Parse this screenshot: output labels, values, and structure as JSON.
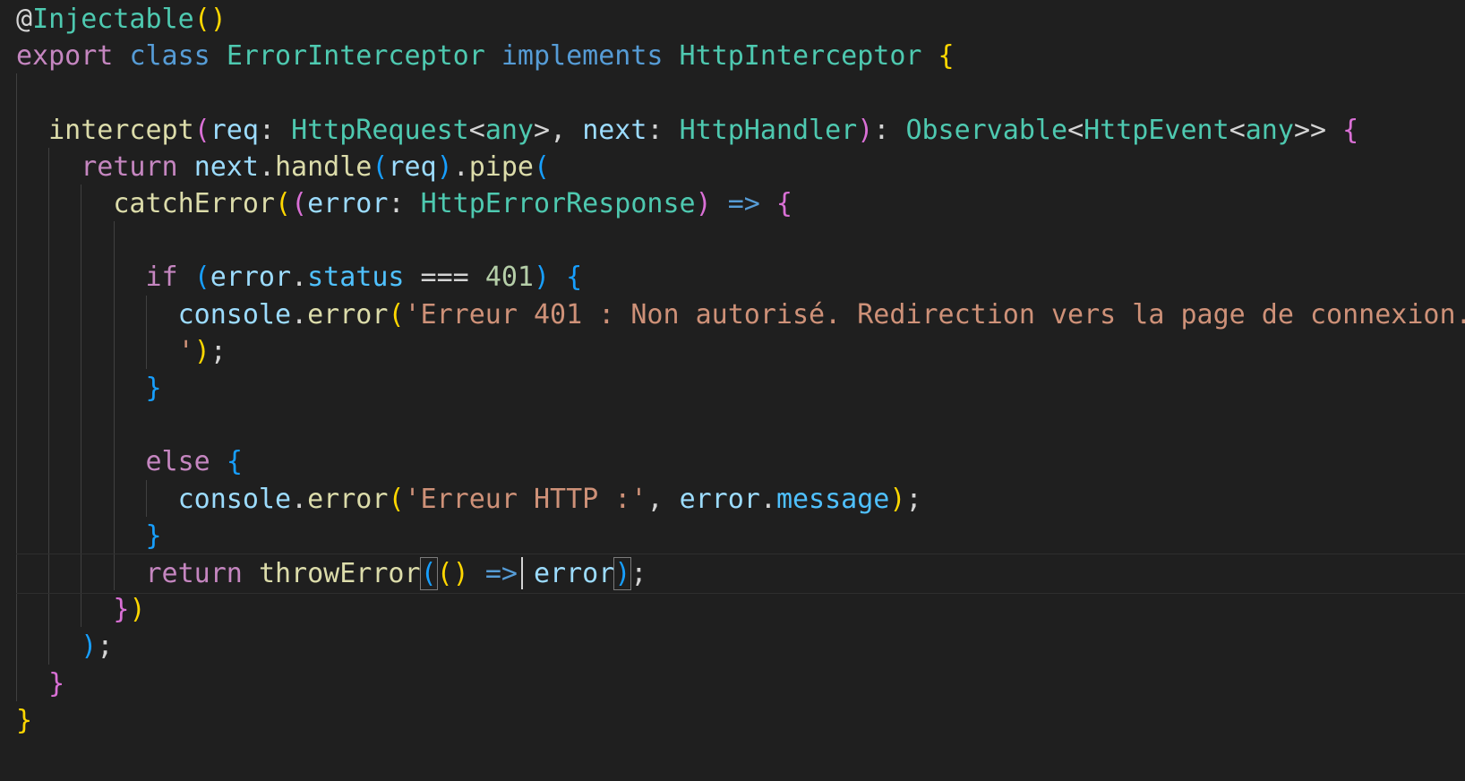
{
  "editor": {
    "language": "typescript",
    "theme_colors": {
      "background": "#1f1f1f",
      "keyword_control": "#c586c0",
      "keyword_storage": "#569cd6",
      "type": "#4ec9b0",
      "function": "#dcdcaa",
      "variable": "#9cdcfe",
      "property": "#4fc1ff",
      "string": "#ce9178",
      "number": "#b5cea8",
      "plain": "#d4d4d4",
      "bracket_gold": "#ffd700",
      "bracket_orchid": "#da70d6",
      "bracket_blue": "#179fff"
    },
    "lines": [
      [
        [
          "@",
          "#d4d4d4"
        ],
        [
          "Injectable",
          "#4ec9b0"
        ],
        [
          "()",
          "#ffd700"
        ]
      ],
      [
        [
          "export",
          "#c586c0"
        ],
        [
          " ",
          "#d4d4d4"
        ],
        [
          "class",
          "#569cd6"
        ],
        [
          " ",
          "#d4d4d4"
        ],
        [
          "ErrorInterceptor",
          "#4ec9b0"
        ],
        [
          " ",
          "#d4d4d4"
        ],
        [
          "implements",
          "#569cd6"
        ],
        [
          " ",
          "#d4d4d4"
        ],
        [
          "HttpInterceptor",
          "#4ec9b0"
        ],
        [
          " ",
          "#d4d4d4"
        ],
        [
          "{",
          "#ffd700"
        ]
      ],
      [],
      [
        [
          "  ",
          "#d4d4d4"
        ],
        [
          "intercept",
          "#dcdcaa"
        ],
        [
          "(",
          "#da70d6"
        ],
        [
          "req",
          "#9cdcfe"
        ],
        [
          ": ",
          "#d4d4d4"
        ],
        [
          "HttpRequest",
          "#4ec9b0"
        ],
        [
          "<",
          "#d4d4d4"
        ],
        [
          "any",
          "#4ec9b0"
        ],
        [
          ">",
          "#d4d4d4"
        ],
        [
          ", ",
          "#d4d4d4"
        ],
        [
          "next",
          "#9cdcfe"
        ],
        [
          ": ",
          "#d4d4d4"
        ],
        [
          "HttpHandler",
          "#4ec9b0"
        ],
        [
          ")",
          "#da70d6"
        ],
        [
          ": ",
          "#d4d4d4"
        ],
        [
          "Observable",
          "#4ec9b0"
        ],
        [
          "<",
          "#d4d4d4"
        ],
        [
          "HttpEvent",
          "#4ec9b0"
        ],
        [
          "<",
          "#d4d4d4"
        ],
        [
          "any",
          "#4ec9b0"
        ],
        [
          ">>",
          "#d4d4d4"
        ],
        [
          " ",
          "#d4d4d4"
        ],
        [
          "{",
          "#da70d6"
        ]
      ],
      [
        [
          "    ",
          "#d4d4d4"
        ],
        [
          "return",
          "#c586c0"
        ],
        [
          " ",
          "#d4d4d4"
        ],
        [
          "next",
          "#9cdcfe"
        ],
        [
          ".",
          "#d4d4d4"
        ],
        [
          "handle",
          "#dcdcaa"
        ],
        [
          "(",
          "#179fff"
        ],
        [
          "req",
          "#9cdcfe"
        ],
        [
          ")",
          "#179fff"
        ],
        [
          ".",
          "#d4d4d4"
        ],
        [
          "pipe",
          "#dcdcaa"
        ],
        [
          "(",
          "#179fff"
        ]
      ],
      [
        [
          "      ",
          "#d4d4d4"
        ],
        [
          "catchError",
          "#dcdcaa"
        ],
        [
          "(",
          "#ffd700"
        ],
        [
          "(",
          "#da70d6"
        ],
        [
          "error",
          "#9cdcfe"
        ],
        [
          ": ",
          "#d4d4d4"
        ],
        [
          "HttpErrorResponse",
          "#4ec9b0"
        ],
        [
          ")",
          "#da70d6"
        ],
        [
          " ",
          "#d4d4d4"
        ],
        [
          "=>",
          "#569cd6"
        ],
        [
          " ",
          "#d4d4d4"
        ],
        [
          "{",
          "#da70d6"
        ]
      ],
      [],
      [
        [
          "        ",
          "#d4d4d4"
        ],
        [
          "if",
          "#c586c0"
        ],
        [
          " ",
          "#d4d4d4"
        ],
        [
          "(",
          "#179fff"
        ],
        [
          "error",
          "#9cdcfe"
        ],
        [
          ".",
          "#d4d4d4"
        ],
        [
          "status",
          "#4fc1ff"
        ],
        [
          " === ",
          "#d4d4d4"
        ],
        [
          "401",
          "#b5cea8"
        ],
        [
          ")",
          "#179fff"
        ],
        [
          " ",
          "#d4d4d4"
        ],
        [
          "{",
          "#179fff"
        ]
      ],
      [
        [
          "          ",
          "#d4d4d4"
        ],
        [
          "console",
          "#9cdcfe"
        ],
        [
          ".",
          "#d4d4d4"
        ],
        [
          "error",
          "#dcdcaa"
        ],
        [
          "(",
          "#ffd700"
        ],
        [
          "'Erreur 401 : Non autorisé. Redirection vers la page de connexion.",
          "#ce9178"
        ]
      ],
      [
        [
          "          ",
          "#d4d4d4"
        ],
        [
          "'",
          "#ce9178"
        ],
        [
          ")",
          "#ffd700"
        ],
        [
          ";",
          "#d4d4d4"
        ]
      ],
      [
        [
          "        ",
          "#d4d4d4"
        ],
        [
          "}",
          "#179fff"
        ]
      ],
      [],
      [
        [
          "        ",
          "#d4d4d4"
        ],
        [
          "else",
          "#c586c0"
        ],
        [
          " ",
          "#d4d4d4"
        ],
        [
          "{",
          "#179fff"
        ]
      ],
      [
        [
          "          ",
          "#d4d4d4"
        ],
        [
          "console",
          "#9cdcfe"
        ],
        [
          ".",
          "#d4d4d4"
        ],
        [
          "error",
          "#dcdcaa"
        ],
        [
          "(",
          "#ffd700"
        ],
        [
          "'Erreur HTTP :'",
          "#ce9178"
        ],
        [
          ", ",
          "#d4d4d4"
        ],
        [
          "error",
          "#9cdcfe"
        ],
        [
          ".",
          "#d4d4d4"
        ],
        [
          "message",
          "#4fc1ff"
        ],
        [
          ")",
          "#ffd700"
        ],
        [
          ";",
          "#d4d4d4"
        ]
      ],
      [
        [
          "        ",
          "#d4d4d4"
        ],
        [
          "}",
          "#179fff"
        ]
      ],
      [
        [
          "        ",
          "#d4d4d4"
        ],
        [
          "return",
          "#c586c0"
        ],
        [
          " ",
          "#d4d4d4"
        ],
        [
          "throwError",
          "#dcdcaa"
        ],
        [
          "(",
          "#179fff",
          "box"
        ],
        [
          "()",
          "#ffd700"
        ],
        [
          " ",
          "#d4d4d4"
        ],
        [
          "=>",
          "#569cd6"
        ],
        [
          " ",
          "#d4d4d4"
        ],
        [
          "error",
          "#9cdcfe"
        ],
        [
          ")",
          "#179fff",
          "box"
        ],
        [
          ";",
          "#d4d4d4"
        ]
      ],
      [
        [
          "      ",
          "#d4d4d4"
        ],
        [
          "}",
          "#da70d6"
        ],
        [
          ")",
          "#ffd700"
        ]
      ],
      [
        [
          "    ",
          "#d4d4d4"
        ],
        [
          ")",
          "#179fff"
        ],
        [
          ";",
          "#d4d4d4"
        ]
      ],
      [
        [
          "  ",
          "#d4d4d4"
        ],
        [
          "}",
          "#da70d6"
        ]
      ],
      [
        [
          "}",
          "#ffd700"
        ]
      ]
    ],
    "current_line": 15
  }
}
